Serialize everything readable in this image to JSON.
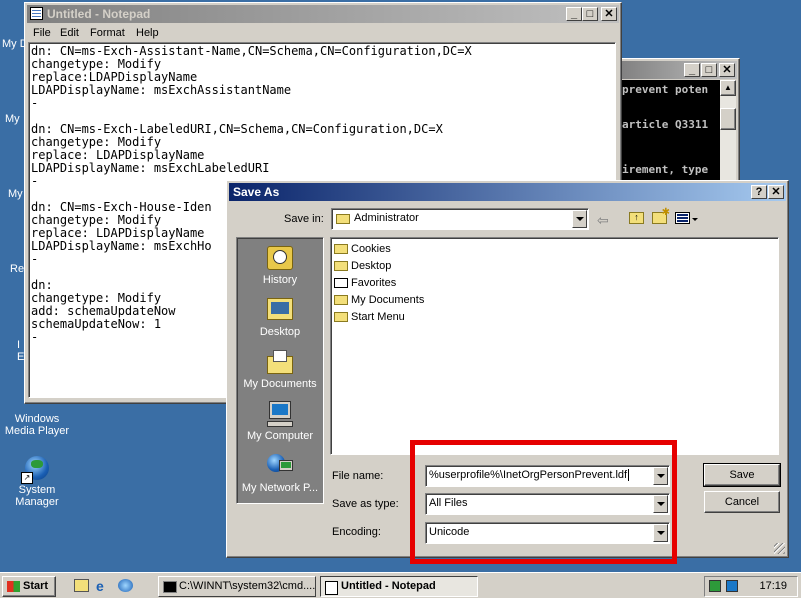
{
  "desktop": {
    "partial_labels": [
      "My D",
      "My",
      "My",
      "Re",
      "I",
      "E"
    ],
    "icons": [
      {
        "label_line1": "Windows",
        "label_line2": "Media Player"
      },
      {
        "label_line1": "System",
        "label_line2": "Manager"
      }
    ]
  },
  "notepad": {
    "title": "Untitled - Notepad",
    "menu": [
      "File",
      "Edit",
      "Format",
      "Help"
    ],
    "lines": [
      "dn: CN=ms-Exch-Assistant-Name,CN=Schema,CN=Configuration,DC=X",
      "changetype: Modify",
      "replace:LDAPDisplayName",
      "LDAPDisplayName: msExchAssistantName",
      "-",
      "",
      "dn: CN=ms-Exch-LabeledURI,CN=Schema,CN=Configuration,DC=X",
      "changetype: Modify",
      "replace: LDAPDisplayName",
      "LDAPDisplayName: msExchLabeledURI",
      "-",
      "",
      "dn: CN=ms-Exch-House-Iden",
      "changetype: Modify",
      "replace: LDAPDisplayName",
      "LDAPDisplayName: msExchHo",
      "-",
      "",
      "dn:",
      "changetype: Modify",
      "add: schemaUpdateNow",
      "schemaUpdateNow: 1",
      "-"
    ]
  },
  "console": {
    "lines": [
      "prevent poten",
      "article Q3311",
      "",
      "irement, type"
    ]
  },
  "save_dialog": {
    "title": "Save As",
    "save_in_label": "Save in:",
    "save_in_value": "Administrator",
    "places": [
      "History",
      "Desktop",
      "My Documents",
      "My Computer",
      "My Network P..."
    ],
    "files": [
      "Cookies",
      "Desktop",
      "Favorites",
      "My Documents",
      "Start Menu"
    ],
    "file_name_label": "File name:",
    "file_name_value": "%userprofile%\\InetOrgPersonPrevent.ldf",
    "save_as_type_label": "Save as type:",
    "save_as_type_value": "All Files",
    "encoding_label": "Encoding:",
    "encoding_value": "Unicode",
    "save_label": "Save",
    "cancel_label": "Cancel",
    "highlight_color": "#e60000"
  },
  "taskbar": {
    "start_label": "Start",
    "tasks": [
      "C:\\WINNT\\system32\\cmd....",
      "Untitled - Notepad"
    ],
    "clock": "17:19"
  }
}
